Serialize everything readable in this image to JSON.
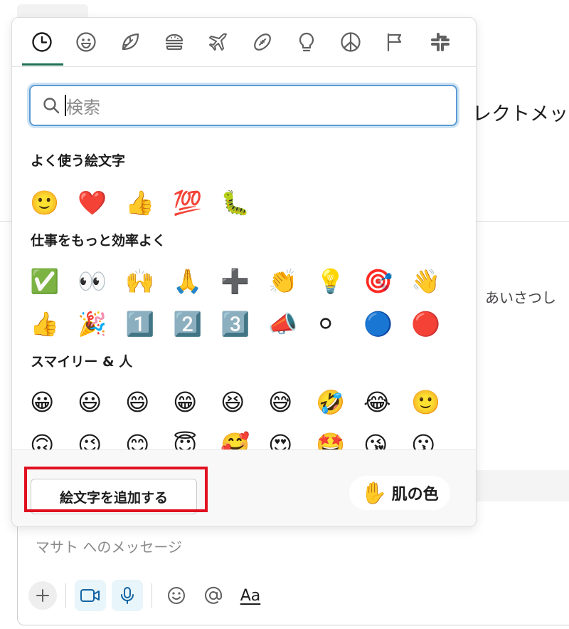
{
  "background": {
    "header_text": "レクトメッ",
    "greeting_text": "あいさつし",
    "composer_placeholder": "マサト へのメッセージ",
    "composer_text_format_label": "Aa"
  },
  "picker": {
    "tabs": [
      {
        "name": "recent",
        "icon": "clock-icon"
      },
      {
        "name": "smileys",
        "icon": "smiley-icon"
      },
      {
        "name": "nature",
        "icon": "leaf-icon"
      },
      {
        "name": "food",
        "icon": "burger-icon"
      },
      {
        "name": "travel",
        "icon": "airplane-icon"
      },
      {
        "name": "activity",
        "icon": "football-icon"
      },
      {
        "name": "objects",
        "icon": "lightbulb-icon"
      },
      {
        "name": "symbols",
        "icon": "peace-icon"
      },
      {
        "name": "flags",
        "icon": "flag-icon"
      },
      {
        "name": "slack",
        "icon": "slack-icon"
      }
    ],
    "search_placeholder": "検索",
    "sections": [
      {
        "title": "よく使う絵文字",
        "rows": [
          [
            "🙂",
            "❤️",
            "👍",
            "💯",
            "🐛"
          ]
        ]
      },
      {
        "title": "仕事をもっと効率よく",
        "rows": [
          [
            "✅",
            "👀",
            "🙌",
            "🙏",
            "➕",
            "👏",
            "💡",
            "🎯",
            "👋"
          ],
          [
            "👍",
            "🎉",
            "1️⃣",
            "2️⃣",
            "3️⃣",
            "📣",
            "⚪",
            "🔵",
            "🔴"
          ]
        ]
      },
      {
        "title": "スマイリー & 人",
        "rows": [
          [
            "😀",
            "😃",
            "😄",
            "😁",
            "😆",
            "😅",
            "🤣",
            "😂",
            "🙂"
          ],
          [
            "🙃",
            "😉",
            "😊",
            "😇",
            "🥰",
            "😍",
            "🤩",
            "😘",
            "😗"
          ]
        ]
      }
    ],
    "add_emoji_label": "絵文字を追加する",
    "skin_tone_label": "肌の色",
    "skin_tone_emoji": "✋"
  },
  "colors": {
    "accent_tab": "#1d6f55",
    "highlight_frame": "#e01020",
    "search_focus": "#5b9bd5"
  }
}
